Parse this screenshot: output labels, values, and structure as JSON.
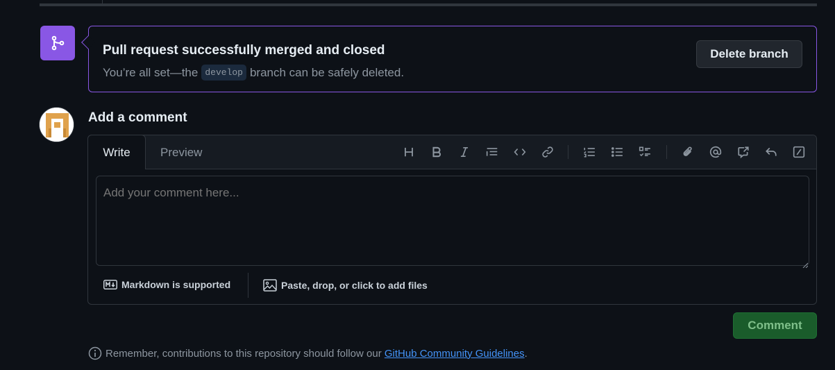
{
  "merge_status": {
    "title": "Pull request successfully merged and closed",
    "desc_before": "You’re all set—the",
    "branch": "develop",
    "desc_after": "branch can be safely deleted.",
    "delete_button": "Delete branch",
    "accent_color": "#8957e5"
  },
  "comment": {
    "heading": "Add a comment",
    "tabs": [
      "Write",
      "Preview"
    ],
    "active_tab": "Write",
    "placeholder": "Add your comment here...",
    "toolbar": [
      "heading-icon",
      "bold-icon",
      "italic-icon",
      "quote-icon",
      "code-icon",
      "link-icon",
      "ordered-list-icon",
      "unordered-list-icon",
      "task-list-icon",
      "attach-icon",
      "mention-icon",
      "reference-icon",
      "reply-icon",
      "slash-commands-icon"
    ],
    "markdown_label": "Markdown is supported",
    "files_label": "Paste, drop, or click to add files",
    "submit_button": "Comment"
  },
  "guidelines": {
    "text": "Remember, contributions to this repository should follow our",
    "link": "GitHub Community Guidelines",
    "suffix": "."
  }
}
